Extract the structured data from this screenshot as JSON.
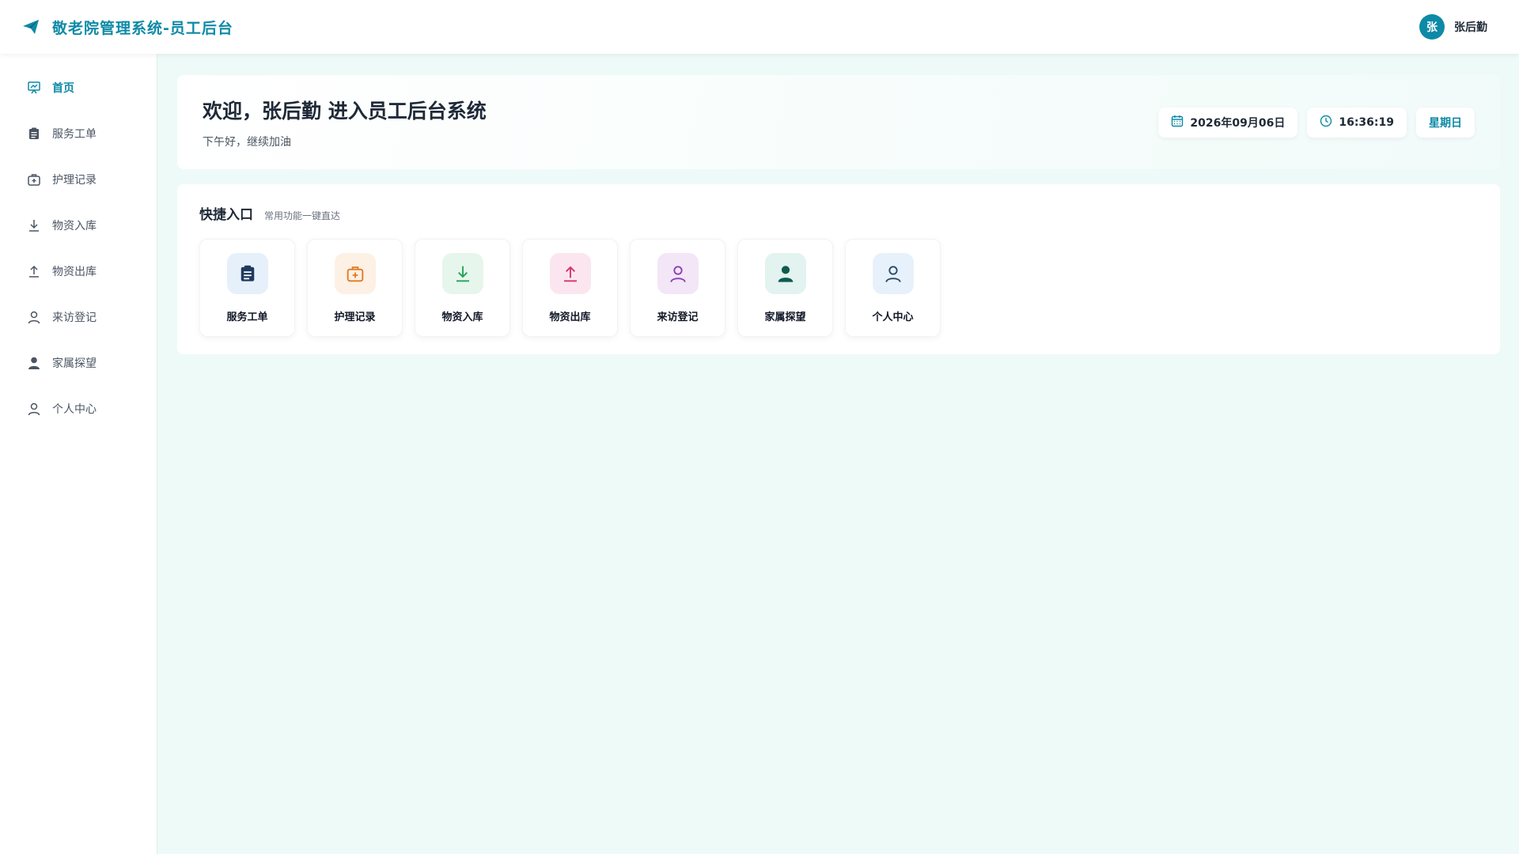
{
  "header": {
    "title": "敬老院管理系统-员工后台",
    "brand_icon": "paper-plane-icon",
    "user": {
      "avatar_text": "张",
      "name": "张后勤"
    }
  },
  "sidebar": {
    "items": [
      {
        "label": "首页",
        "icon": "presentation-icon",
        "active": true
      },
      {
        "label": "服务工单",
        "icon": "clipboard-icon"
      },
      {
        "label": "护理记录",
        "icon": "first-aid-kit-icon"
      },
      {
        "label": "物资入库",
        "icon": "download-icon"
      },
      {
        "label": "物资出库",
        "icon": "upload-icon"
      },
      {
        "label": "来访登记",
        "icon": "user-outline-icon"
      },
      {
        "label": "家属探望",
        "icon": "user-filled-icon"
      },
      {
        "label": "个人中心",
        "icon": "user-outline-icon"
      }
    ]
  },
  "welcome": {
    "title": "欢迎，张后勤 进入员工后台系统",
    "subtitle": "下午好，继续加油",
    "date": "2026年09月06日",
    "time": "16:36:19",
    "weekday": "星期日"
  },
  "quick": {
    "title": "快捷入口",
    "subtitle": "常用功能一键直达",
    "items": [
      {
        "label": "服务工单",
        "icon": "clipboard-icon",
        "bg": "#e6f0fb",
        "color": "#1e3a5f"
      },
      {
        "label": "护理记录",
        "icon": "first-aid-kit-icon",
        "bg": "#fdf0e4",
        "color": "#e07b1f"
      },
      {
        "label": "物资入库",
        "icon": "download-icon",
        "bg": "#e6f6ec",
        "color": "#22a356"
      },
      {
        "label": "物资出库",
        "icon": "upload-icon",
        "bg": "#fbe6ef",
        "color": "#d6336c"
      },
      {
        "label": "来访登记",
        "icon": "user-outline-icon",
        "bg": "#f2e6f7",
        "color": "#8e3fb0"
      },
      {
        "label": "家属探望",
        "icon": "user-filled-icon",
        "bg": "#e2f3f0",
        "color": "#0f5a50"
      },
      {
        "label": "个人中心",
        "icon": "user-outline-icon",
        "bg": "#e7f1fb",
        "color": "#2c4a66"
      }
    ]
  },
  "colors": {
    "accent": "#0e8aa6",
    "background": "#eefaf8"
  }
}
